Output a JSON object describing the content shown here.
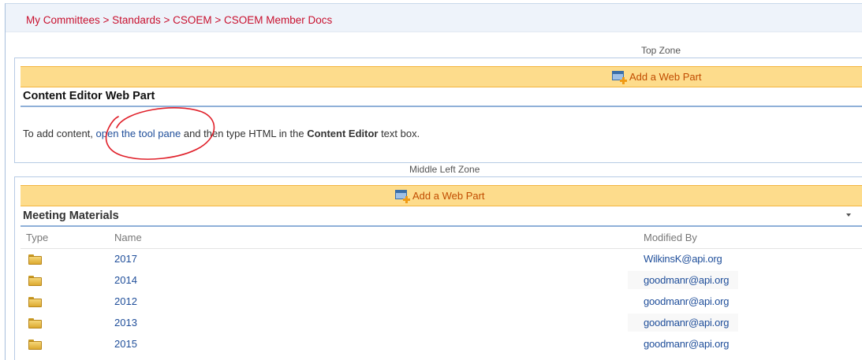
{
  "breadcrumb": {
    "items": [
      "My Committees",
      "Standards",
      "CSOEM",
      "CSOEM Member Docs"
    ],
    "separator": " > "
  },
  "top_zone": {
    "label": "Top Zone",
    "add_web_part": "Add a Web Part",
    "web_part": {
      "title": "Content Editor Web Part",
      "text_before": "To add content, ",
      "link": "open the tool pane",
      "text_middle": " and then type HTML in the ",
      "bold": "Content Editor",
      "text_after": " text box."
    }
  },
  "middle_left_zone": {
    "label": "Middle Left Zone",
    "add_web_part": "Add a Web Part",
    "web_part": {
      "title": "Meeting Materials",
      "columns": [
        "Type",
        "Name",
        "Modified By"
      ],
      "rows": [
        {
          "type_icon": "folder-icon",
          "name": "2017",
          "modified_by": "WilkinsK@api.org"
        },
        {
          "type_icon": "folder-icon",
          "name": "2014",
          "modified_by": "goodmanr@api.org"
        },
        {
          "type_icon": "folder-icon",
          "name": "2012",
          "modified_by": "goodmanr@api.org"
        },
        {
          "type_icon": "folder-icon",
          "name": "2013",
          "modified_by": "goodmanr@api.org"
        },
        {
          "type_icon": "folder-icon",
          "name": "2015",
          "modified_by": "goodmanr@api.org"
        }
      ]
    }
  },
  "colors": {
    "breadcrumb": "#c8102e",
    "add_bar": "#fddc8c",
    "link": "#1f4e9a",
    "add_link": "#c14c00",
    "annotation": "#e0202a"
  }
}
